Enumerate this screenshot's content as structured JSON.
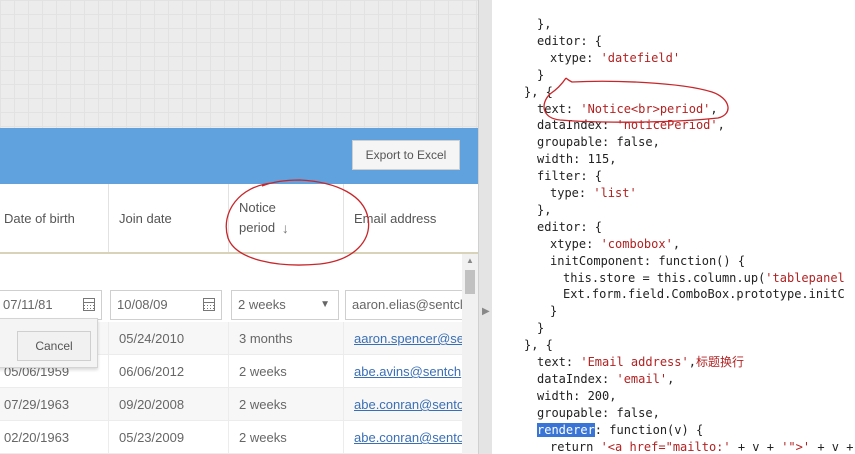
{
  "toolbar": {
    "export_label": "Export to Excel"
  },
  "columns": [
    {
      "label": "Date of birth"
    },
    {
      "label": "Join date"
    },
    {
      "label": "Notice\nperiod",
      "sort_icon": "arrow-down-icon"
    },
    {
      "label": "Email address"
    }
  ],
  "editor": {
    "dob": "07/11/81",
    "join": "10/08/09",
    "notice": "2 weeks",
    "email": "aaron.elias@sentcl"
  },
  "rows": [
    {
      "dob": "",
      "join": "05/24/2010",
      "notice": "3 months",
      "email": "aaron.spencer@se"
    },
    {
      "dob": "05/06/1959",
      "join": "06/06/2012",
      "notice": "2 weeks",
      "email": "abe.avins@sentch"
    },
    {
      "dob": "07/29/1963",
      "join": "09/20/2008",
      "notice": "2 weeks",
      "email": "abe.conran@sento"
    },
    {
      "dob": "02/20/1963",
      "join": "05/23/2009",
      "notice": "2 weeks",
      "email": "abe.conran@sento"
    }
  ],
  "row_editor": {
    "cancel_label": "Cancel"
  },
  "code_lines": [
    {
      "indent": 3,
      "text": "},"
    },
    {
      "indent": 3,
      "text": "editor: {"
    },
    {
      "indent": 4,
      "pre": "xtype: ",
      "str": "'datefield'"
    },
    {
      "indent": 3,
      "text": "}"
    },
    {
      "indent": 2,
      "text": "}, {"
    },
    {
      "indent": 3,
      "pre": "text: ",
      "str": "'Notice<br>period'",
      "post": ","
    },
    {
      "indent": 3,
      "pre": "dataIndex: ",
      "str": "'noticePeriod'",
      "post": ","
    },
    {
      "indent": 3,
      "text": "groupable: false,"
    },
    {
      "indent": 3,
      "text": "width: 115,"
    },
    {
      "indent": 3,
      "text": "filter: {"
    },
    {
      "indent": 4,
      "pre": "type: ",
      "str": "'list'"
    },
    {
      "indent": 3,
      "text": "},"
    },
    {
      "indent": 3,
      "text": "editor: {"
    },
    {
      "indent": 4,
      "pre": "xtype: ",
      "str": "'combobox'",
      "post": ","
    },
    {
      "indent": 4,
      "text": "initComponent: function() {"
    },
    {
      "indent": 5,
      "pre": "this.store = this.column.up(",
      "str": "'tablepanel"
    },
    {
      "indent": 5,
      "text": "Ext.form.field.ComboBox.prototype.initC"
    },
    {
      "indent": 4,
      "text": "}"
    },
    {
      "indent": 3,
      "text": "}"
    },
    {
      "indent": 2,
      "text": "}, {"
    },
    {
      "indent": 3,
      "pre": "text: ",
      "str": "'Email address'",
      "post": ",",
      "zh": "标题换行"
    },
    {
      "indent": 3,
      "pre": "dataIndex: ",
      "str": "'email'",
      "post": ","
    },
    {
      "indent": 3,
      "text": "width: 200,"
    },
    {
      "indent": 3,
      "text": "groupable: false,"
    },
    {
      "indent": 3,
      "hl": "renderer",
      "post": ": function(v) {"
    },
    {
      "indent": 4,
      "pre": "return ",
      "str": "'<a href=\"mailto:'",
      "post": " + v + ",
      "str2": "'\">'",
      "post2": " + v + "
    }
  ],
  "colors": {
    "header_blue": "#5fa2dd",
    "annotation_red": "#c8262a",
    "string_red": "#b22222",
    "selection_blue": "#3875d7"
  }
}
